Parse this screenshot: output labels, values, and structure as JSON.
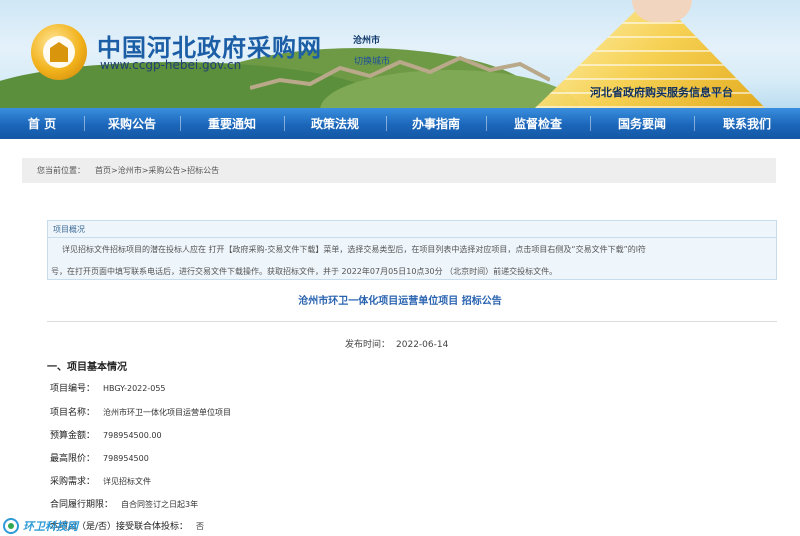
{
  "header": {
    "site_title": "中国河北政府采购网",
    "site_url": "www.ccgp-hebei.gov.cn",
    "city": "沧州市",
    "switch_city": "切换城市",
    "platform": "河北省政府购买服务信息平台"
  },
  "nav": {
    "items": [
      "首 页",
      "采购公告",
      "重要通知",
      "政策法规",
      "办事指南",
      "监督检查",
      "国务要闻",
      "联系我们"
    ]
  },
  "breadcrumb": {
    "label": "您当前位置：",
    "path": "首页>沧州市>采购公告>招标公告"
  },
  "overview": {
    "title": "项目概况",
    "line1": "详见招标文件招标项目的潜在投标人应在 打开【政府采购-交易文件下载】菜单，选择交易类型后，在项目列表中选择对应项目，点击项目右侧及“交易文件下载”的l符",
    "line2": "号，在打开页面中填写联系电话后，进行交易文件下载操作。获取招标文件，并于 2022年07月05日10点30分 （北京时间）前递交投标文件。"
  },
  "announcement": {
    "title": "沧州市环卫一体化项目运营单位项目 招标公告",
    "publish_label": "发布时间：",
    "publish_date": "2022-06-14"
  },
  "section1": {
    "heading": "一、项目基本情况",
    "rows": [
      {
        "label": "项目编号：",
        "value": "HBGY-2022-055"
      },
      {
        "label": "项目名称：",
        "value": "沧州市环卫一体化项目运营单位项目"
      },
      {
        "label": "预算金额：",
        "value": "798954500.00"
      },
      {
        "label": "最高限价：",
        "value": "798954500"
      },
      {
        "label": "采购需求：",
        "value": "详见招标文件"
      },
      {
        "label": "合同履行期限：",
        "value": "自合同签订之日起3年"
      },
      {
        "label": "本项目（是/否）接受联合体投标：",
        "value": "否"
      }
    ]
  },
  "watermark": {
    "text": "环卫科技网"
  },
  "colors": {
    "nav_blue": "#1b66ba",
    "title_blue": "#1b5ea6",
    "announcement_blue": "#2a64b0",
    "breadcrumb_bg": "#eeeeee",
    "overview_bg": "#eef5fb"
  }
}
